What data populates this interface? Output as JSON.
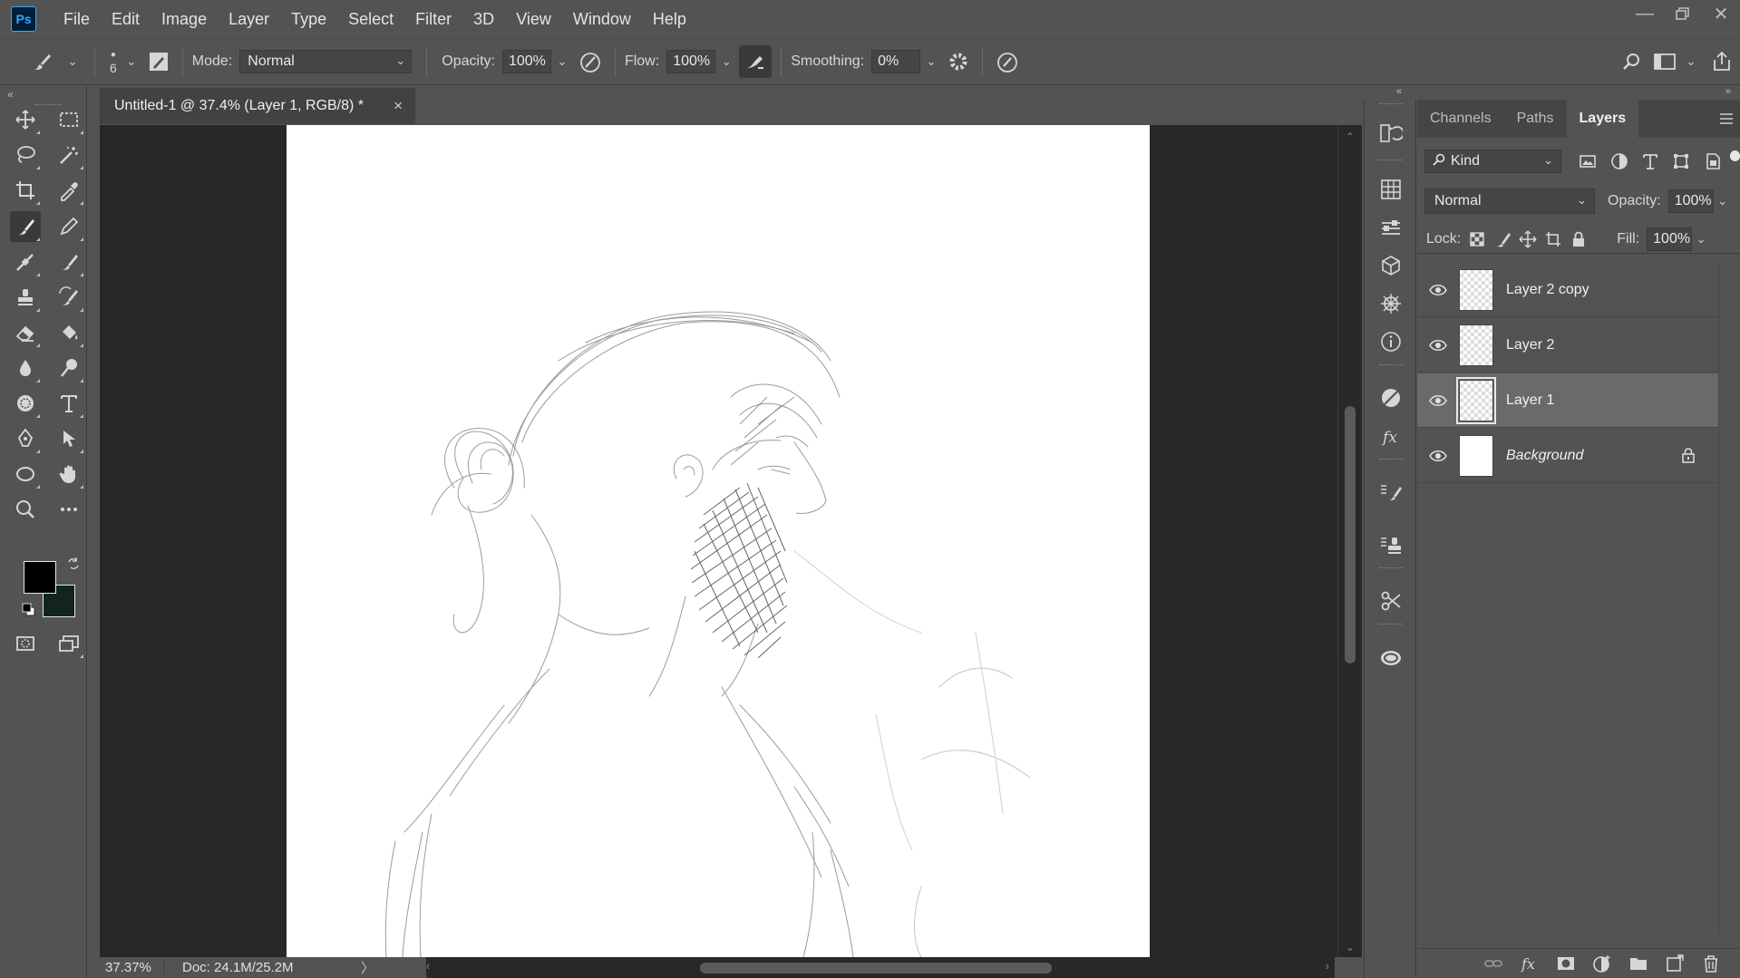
{
  "app": {
    "logo": "Ps",
    "window_controls": [
      "minimize-icon",
      "restore-icon",
      "close-icon"
    ]
  },
  "menu": [
    "File",
    "Edit",
    "Image",
    "Layer",
    "Type",
    "Select",
    "Filter",
    "3D",
    "View",
    "Window",
    "Help"
  ],
  "options_bar": {
    "brush_size": "6",
    "mode_label": "Mode:",
    "mode_value": "Normal",
    "opacity_label": "Opacity:",
    "opacity_value": "100%",
    "flow_label": "Flow:",
    "flow_value": "100%",
    "smoothing_label": "Smoothing:",
    "smoothing_value": "0%"
  },
  "document": {
    "tab_title": "Untitled-1 @ 37.4% (Layer 1, RGB/8) *",
    "close_glyph": "×"
  },
  "status": {
    "zoom": "37.37%",
    "doc_size": "Doc: 24.1M/25.2M",
    "arrow": "〉"
  },
  "colors": {
    "foreground": "#000000",
    "background": "#112420",
    "accent": "#31a8ff"
  },
  "layers_panel": {
    "tabs": [
      "Channels",
      "Paths",
      "Layers"
    ],
    "active_tab": "Layers",
    "filter_kind": "Kind",
    "blend_mode": "Normal",
    "opacity_label": "Opacity:",
    "opacity_value": "100%",
    "lock_label": "Lock:",
    "fill_label": "Fill:",
    "fill_value": "100%",
    "layers": [
      {
        "name": "Layer 2 copy",
        "visible": true,
        "selected": false,
        "locked": false,
        "thumb": "transparent"
      },
      {
        "name": "Layer 2",
        "visible": true,
        "selected": false,
        "locked": false,
        "thumb": "transparent"
      },
      {
        "name": "Layer 1",
        "visible": true,
        "selected": true,
        "locked": false,
        "thumb": "transparent"
      },
      {
        "name": "Background",
        "visible": true,
        "selected": false,
        "locked": true,
        "thumb": "white"
      }
    ]
  }
}
